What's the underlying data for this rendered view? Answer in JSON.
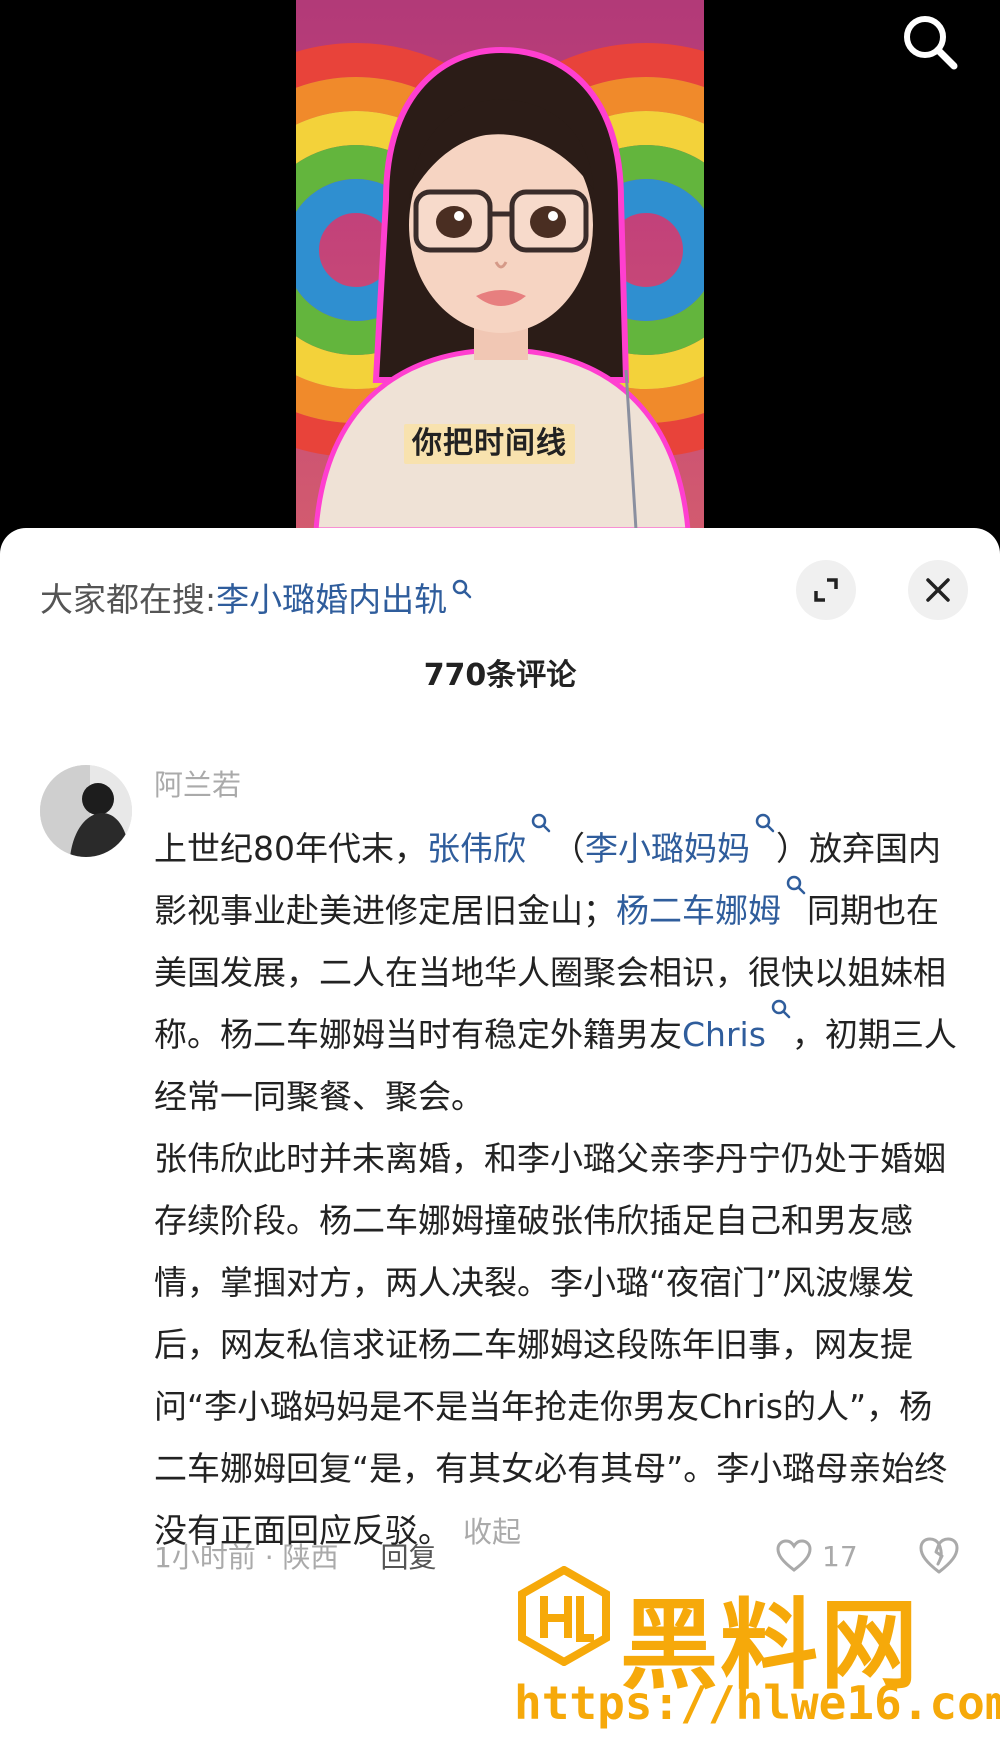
{
  "video": {
    "subtitle": "你把时间线"
  },
  "sheet": {
    "search_prefix": "大家都在搜:",
    "search_term": "李小璐婚内出轨",
    "comment_count": "770条评论"
  },
  "comment": {
    "username": "阿兰若",
    "p1_a": "上世纪80年代末，",
    "p1_link1": "张伟欣",
    "p1_b": "（",
    "p1_link2": "李小璐妈妈",
    "p1_c": "）放弃国内影视事业赴美进修定居旧金山；",
    "p1_link3": "杨二车娜姆",
    "p1_d": "同期也在美国发展，二人在当地华人圈聚会相识，很快以姐妹相称。杨二车娜姆当时有稳定外籍男友",
    "p1_link4": "Chris",
    "p1_e": "，初期三人经常一同聚餐、聚会。",
    "p2": "张伟欣此时并未离婚，和李小璐父亲李丹宁仍处于婚姻存续阶段。杨二车娜姆撞破张伟欣插足自己和男友感情，掌掴对方，两人决裂。李小璐“夜宿门”风波爆发后，网友私信求证杨二车娜姆这段陈年旧事，网友提问“李小璐妈妈是不是当年抢走你男友Chris的人”，杨二车娜姆回复“是，有其女必有其母”。李小璐母亲始终没有正面回应反驳。",
    "collapse": "收起",
    "meta": "1小时前 · 陕西",
    "reply": "回复",
    "likes": "17"
  },
  "watermark": {
    "text": "黑料网",
    "url": "https://hlwe16.com"
  }
}
